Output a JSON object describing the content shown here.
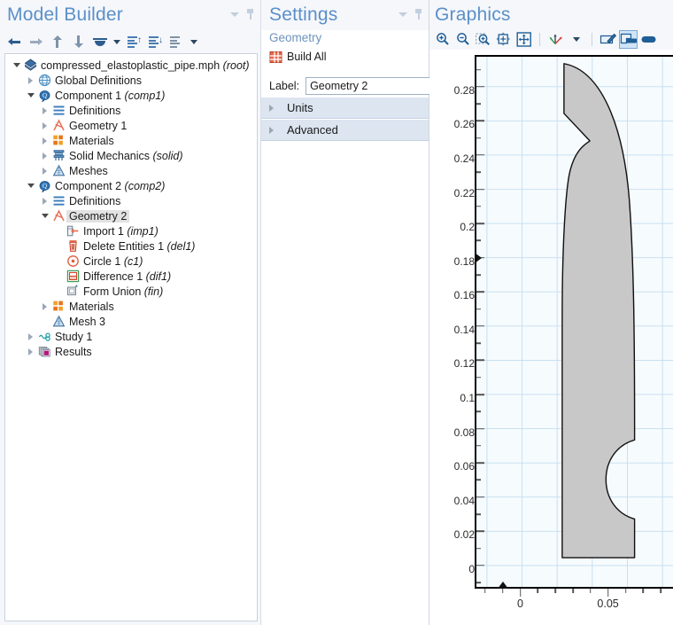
{
  "model_builder": {
    "title": "Model Builder",
    "toolbar": [
      {
        "name": "go-back-icon",
        "label": "Go to Previous Node"
      },
      {
        "name": "go-forward-icon",
        "label": "Go to Next Node"
      },
      {
        "name": "move-up-icon",
        "label": "Move Up"
      },
      {
        "name": "move-down-icon",
        "label": "Move Down"
      },
      {
        "name": "show-hide-eye-icon",
        "label": "Show"
      },
      {
        "name": "chevron-down-icon",
        "label": "Show Options"
      },
      {
        "name": "collapse-all-icon",
        "label": "Collapse All"
      },
      {
        "name": "expand-all-icon",
        "label": "Expand All"
      },
      {
        "name": "list-options-icon",
        "label": "Node Options"
      },
      {
        "name": "chevron-down-icon-2",
        "label": "More Options"
      }
    ],
    "tree": [
      {
        "depth": 0,
        "twisty": "open",
        "icon": "model-root-icon",
        "label": "compressed_elastoplastic_pipe.mph",
        "tag": "(root)",
        "selected": false
      },
      {
        "depth": 1,
        "twisty": "closed",
        "icon": "globe-icon",
        "label": "Global Definitions",
        "tag": "",
        "selected": false
      },
      {
        "depth": 1,
        "twisty": "open",
        "icon": "component-icon",
        "label": "Component 1",
        "tag": "(comp1)",
        "selected": false
      },
      {
        "depth": 2,
        "twisty": "closed",
        "icon": "definitions-icon",
        "label": "Definitions",
        "tag": "",
        "selected": false
      },
      {
        "depth": 2,
        "twisty": "closed",
        "icon": "geometry-icon",
        "label": "Geometry 1",
        "tag": "",
        "selected": false
      },
      {
        "depth": 2,
        "twisty": "closed",
        "icon": "materials-icon",
        "label": "Materials",
        "tag": "",
        "selected": false
      },
      {
        "depth": 2,
        "twisty": "closed",
        "icon": "solid-mechanics-icon",
        "label": "Solid Mechanics",
        "tag": "(solid)",
        "selected": false
      },
      {
        "depth": 2,
        "twisty": "closed",
        "icon": "mesh-icon",
        "label": "Meshes",
        "tag": "",
        "selected": false
      },
      {
        "depth": 1,
        "twisty": "open",
        "icon": "component-icon",
        "label": "Component 2",
        "tag": "(comp2)",
        "selected": false
      },
      {
        "depth": 2,
        "twisty": "closed",
        "icon": "definitions-icon",
        "label": "Definitions",
        "tag": "",
        "selected": false
      },
      {
        "depth": 2,
        "twisty": "open",
        "icon": "geometry-icon",
        "label": "Geometry 2",
        "tag": "",
        "selected": true
      },
      {
        "depth": 3,
        "twisty": "none",
        "icon": "import-icon",
        "label": "Import 1",
        "tag": "(imp1)",
        "selected": false
      },
      {
        "depth": 3,
        "twisty": "none",
        "icon": "delete-entities-icon",
        "label": "Delete Entities 1",
        "tag": "(del1)",
        "selected": false
      },
      {
        "depth": 3,
        "twisty": "none",
        "icon": "circle-icon",
        "label": "Circle 1",
        "tag": "(c1)",
        "selected": false
      },
      {
        "depth": 3,
        "twisty": "none",
        "icon": "difference-icon",
        "label": "Difference 1",
        "tag": "(dif1)",
        "selected": false
      },
      {
        "depth": 3,
        "twisty": "none",
        "icon": "form-union-icon",
        "label": "Form Union",
        "tag": "(fin)",
        "selected": false
      },
      {
        "depth": 2,
        "twisty": "closed",
        "icon": "materials-icon",
        "label": "Materials",
        "tag": "",
        "selected": false
      },
      {
        "depth": 2,
        "twisty": "none",
        "icon": "mesh-icon",
        "label": "Mesh 3",
        "tag": "",
        "selected": false
      },
      {
        "depth": 1,
        "twisty": "closed",
        "icon": "study-icon",
        "label": "Study 1",
        "tag": "",
        "selected": false
      },
      {
        "depth": 1,
        "twisty": "closed",
        "icon": "results-icon",
        "label": "Results",
        "tag": "",
        "selected": false
      }
    ]
  },
  "settings": {
    "title": "Settings",
    "subtitle": "Geometry",
    "build_all_label": "Build All",
    "build_all_icon": "build-all-icon",
    "label_caption": "Label:",
    "label_value": "Geometry 2",
    "label_placeholder": "",
    "sections": [
      {
        "label": "Units",
        "expanded": false
      },
      {
        "label": "Advanced",
        "expanded": false
      }
    ]
  },
  "graphics": {
    "title": "Graphics",
    "toolbar": [
      {
        "name": "zoom-in-icon",
        "label": "Zoom In",
        "active": false
      },
      {
        "name": "zoom-out-icon",
        "label": "Zoom Out",
        "active": false
      },
      {
        "name": "zoom-box-icon",
        "label": "Zoom Box",
        "active": false
      },
      {
        "name": "zoom-extents-icon",
        "label": "Zoom Extents",
        "active": false
      },
      {
        "name": "zoom-to-selection-icon",
        "label": "Zoom to Selection",
        "active": false
      },
      {
        "name": "axis-orientation-icon",
        "label": "Go to View",
        "active": false
      },
      {
        "name": "chevron-down-icon",
        "label": "View Options",
        "active": false
      },
      {
        "name": "select-all-icon",
        "label": "Select All",
        "active": false
      },
      {
        "name": "select-box-icon",
        "label": "Select Box",
        "active": true
      },
      {
        "name": "deselect-icon",
        "label": "Clear Selection",
        "active": false
      }
    ]
  },
  "chart_data": {
    "type": "scatter",
    "title": "",
    "xlabel": "",
    "ylabel": "",
    "grid": true,
    "xlim": [
      -0.026,
      0.086
    ],
    "ylim": [
      -0.0125,
      0.2975
    ],
    "y_major_ticks": [
      0,
      0.02,
      0.04,
      0.06,
      0.08,
      0.1,
      0.12,
      0.14,
      0.16,
      0.18,
      0.2,
      0.22,
      0.24,
      0.26,
      0.28
    ],
    "y_major_labels": [
      "0",
      "0.02",
      "0.04",
      "0.06",
      "0.08",
      "0.1",
      "0.12",
      "0.14",
      "0.16",
      "0.18",
      "0.2",
      "0.22",
      "0.24",
      "0.26",
      "0.28"
    ],
    "y_minor_step": 0.01,
    "x_major_ticks": [
      0,
      0.05
    ],
    "x_major_labels": [
      "0",
      "0.05"
    ],
    "x_minor_step": 0.01,
    "y_axis_marker": 0.18,
    "x_axis_marker": -0.01,
    "geometry": {
      "name": "curved-pipe-section",
      "fill_color": "#c8c8c8",
      "stroke_color": "#111111",
      "background_color": "#f6fbfe",
      "gridline_color": "#c3ddee"
    }
  }
}
